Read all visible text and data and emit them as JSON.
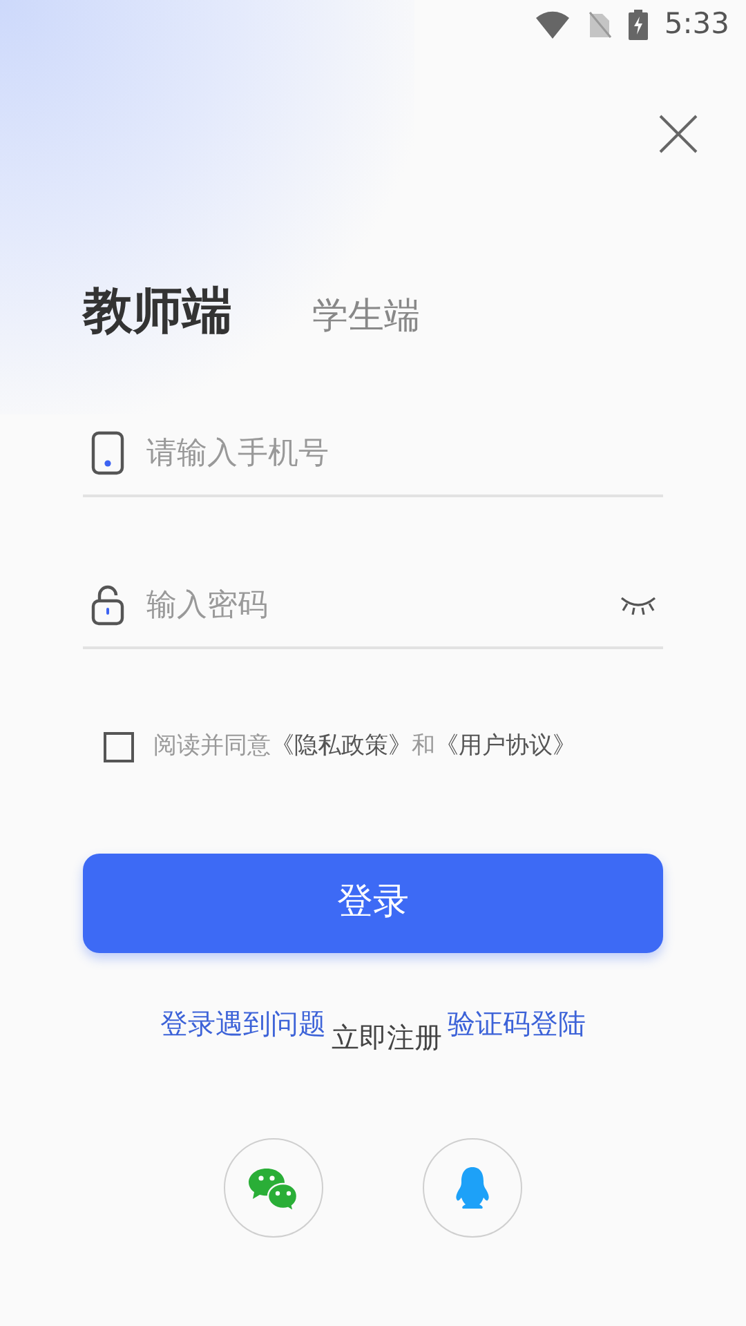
{
  "status_bar": {
    "time": "5:33"
  },
  "tabs": [
    {
      "label": "教师端",
      "selected": true
    },
    {
      "label": "学生端",
      "selected": false
    }
  ],
  "fields": [
    {
      "kind": "phone",
      "placeholder": "请输入手机号"
    },
    {
      "kind": "password",
      "placeholder": "输入密码"
    }
  ],
  "agreement": {
    "checked": false,
    "prefix": "阅读并同意",
    "privacy_link": "《隐私政策》",
    "conjunction": "和",
    "terms_link": "《用户协议》"
  },
  "login_button": "登录",
  "links": [
    {
      "kind": "link",
      "label": "登录遇到问题"
    },
    {
      "kind": "plain",
      "label": "立即注册"
    },
    {
      "kind": "link",
      "label": "验证码登陆"
    }
  ],
  "social": [
    {
      "kind": "wechat"
    },
    {
      "kind": "qq"
    }
  ]
}
